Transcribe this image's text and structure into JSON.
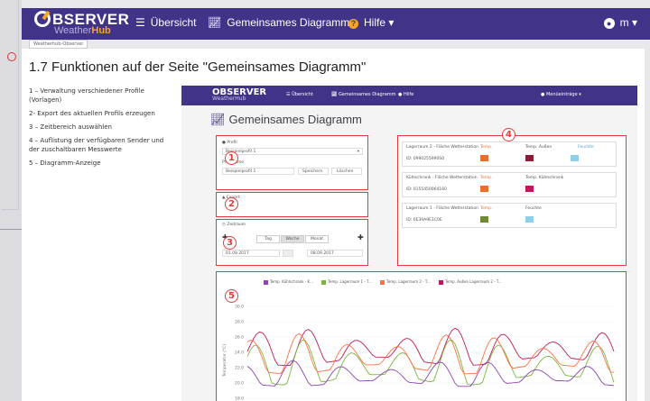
{
  "nav": {
    "logo_main": "BSERVER",
    "logo_sub_a": "Weather",
    "logo_sub_b": "Hub",
    "overview": "Übersicht",
    "chart": "Gemeinsames Diagramm",
    "help": "Hilfe",
    "user_suffix": "m"
  },
  "breadcrumb": "Weatherhub-Observer",
  "doc": {
    "heading": "1.7 Funktionen auf der Seite \"Gemeinsames Diagramm\"",
    "items": [
      "1 – Verwaltung verschiedener Profile (Vorlagen)",
      "2- Export des aktuellen Profils erzeugen",
      "3 – Zeitbereich auswählen",
      "4 – Auflistung der verfügbaren Sender und der zuschaltbaren Messwerte",
      "5 – Diagramm-Anzeige"
    ]
  },
  "inner": {
    "logo": "OBSERVER",
    "logo_sub": "WeatherHub",
    "overview": "Übersicht",
    "chart": "Gemeinsames Diagramm",
    "help": "Hilfe",
    "user": "Menüeinträge ▾",
    "title": "Gemeinsames Diagramm",
    "profile_label": "Profil",
    "profile_value": "Beispielprofil 1",
    "profile_name_label": "Profilname",
    "profile_name_value": "Beispielprofil 1",
    "save": "Speichern",
    "delete": "Löschen",
    "export_label": "Export",
    "export_pdf": "PDF",
    "range_label": "Zeitraum",
    "seg_day": "Tag",
    "seg_week": "Woche",
    "seg_month": "Monat",
    "date_from": "01.09.2017",
    "date_to": "08.09.2017",
    "sensors": [
      {
        "name": "Lagerraum 2 - Fläche Wetterstation",
        "id": "ID: 0990255990S0",
        "m1": "Temp.",
        "m2": "Temp. Außen",
        "m3": "Feuchte"
      },
      {
        "name": "Kühlschrank - Fläche Wetterstation",
        "id": "ID: 0155450064160",
        "m1": "Temp.",
        "m2": "Temp. Kühlschrank",
        "m3": ""
      },
      {
        "name": "Lagerraum 1 - Fläche Wetterstation",
        "id": "ID: 0E39A9E1C0E",
        "m1": "Temp.",
        "m2": "Feuchte",
        "m3": ""
      }
    ],
    "legend": [
      "Temp. Kühlschrank - K...",
      "Temp. Lagerraum 1 - T...",
      "Temp. Lagerraum 2 - T...",
      "Temp. Außen Lagerraum 2 - T..."
    ],
    "y_axis": "Temperatur (°C)",
    "y_ticks": [
      "30.0",
      "28.0",
      "26.0",
      "24.0",
      "22.0",
      "20.0",
      "18.0"
    ]
  },
  "badges": [
    "1",
    "2",
    "3",
    "4",
    "5"
  ],
  "colors": {
    "brand": "#413488",
    "accent": "#f6a623",
    "highlight": "#e53a3a",
    "series": [
      "#8e44ad",
      "#7cb342",
      "#ff7043",
      "#c2185b"
    ]
  }
}
